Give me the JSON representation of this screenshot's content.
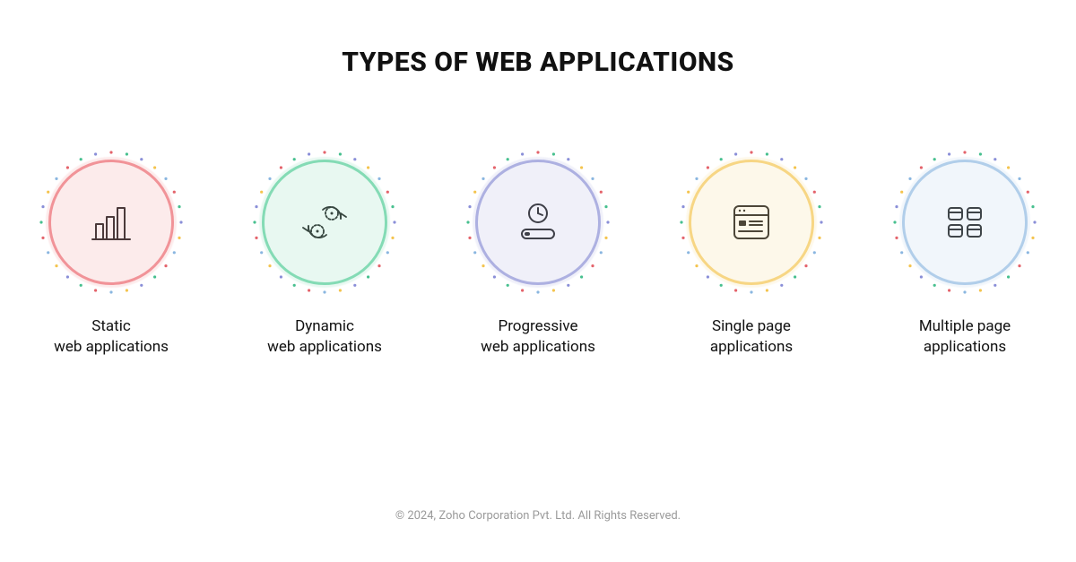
{
  "title": "TYPES OF WEB APPLICATIONS",
  "footer": "© 2024, Zoho Corporation Pvt. Ltd. All Rights Reserved.",
  "dot_colors": [
    "#e4636b",
    "#47c08f",
    "#8a8fd8",
    "#f4c44e",
    "#8ab6e0"
  ],
  "items": [
    {
      "label": "Static\nweb applications",
      "icon": "bar-chart-icon",
      "ring_color": "#f08a8f",
      "halo_color": "#f6b1b4"
    },
    {
      "label": "Dynamic\nweb applications",
      "icon": "sync-gears-icon",
      "ring_color": "#79d8ae",
      "halo_color": "#a8e6cb"
    },
    {
      "label": "Progressive\nweb applications",
      "icon": "clock-loader-icon",
      "ring_color": "#a6a9df",
      "halo_color": "#c5c7ea"
    },
    {
      "label": "Single page\napplications",
      "icon": "browser-window-icon",
      "ring_color": "#f6d277",
      "halo_color": "#fae5ad"
    },
    {
      "label": "Multiple page\napplications",
      "icon": "grid-pages-icon",
      "ring_color": "#a9c9e8",
      "halo_color": "#cadef1"
    }
  ]
}
